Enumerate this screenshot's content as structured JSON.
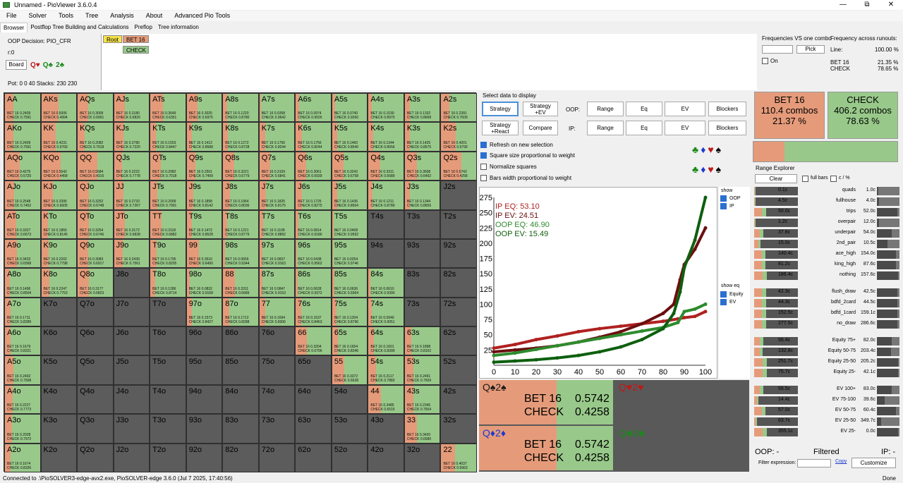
{
  "window": {
    "title": "Unnamed - PioViewer 3.6.0.4",
    "min": "—",
    "max": "⧉",
    "close": "✕"
  },
  "menu": [
    "File",
    "Solver",
    "Tools",
    "Tree",
    "Analysis",
    "About",
    "Advanced Pio Tools"
  ],
  "tabs": [
    "Browser",
    "Postflop Tree Building and Calculations",
    "Preflop",
    "Tree information"
  ],
  "info": {
    "decision": "OOP Decision:  PIO_CFR",
    "r": "r:0",
    "board_button": "Board",
    "cards": [
      "Q♥",
      "Q♣",
      "2♣"
    ],
    "pot": "Pot: 0 0 40 Stacks: 230 230"
  },
  "tree": {
    "root": "Root",
    "bet": "BET 16",
    "check": "CHECK"
  },
  "freq": {
    "vs_one_combo": "Frequencies VS one combo",
    "pick": "Pick",
    "on": "On",
    "across": "Frequency across runouts:",
    "line": "Line:",
    "line_val": "100.00 %",
    "bet": "BET 16",
    "bet_val": "21.35 %",
    "check": "CHECK",
    "check_val": "78.65 %"
  },
  "select": {
    "label": "Select data to display",
    "strategy": "Strategy",
    "strategy_ev": "Strategy\n+EV",
    "strategy_react": "Strategy\n+React",
    "compare": "Compare",
    "oop": "OOP:",
    "ip": "IP:",
    "range": "Range",
    "eq": "Eq",
    "ev": "EV",
    "blockers": "Blockers"
  },
  "checks": {
    "refresh": "Refresh on new selection",
    "square": "Square size proportional to weight",
    "normalize": "Normalize squares",
    "bars": "Bars width proportional to weight"
  },
  "suits": [
    "♣",
    "♦",
    "♥",
    "♠"
  ],
  "actions": {
    "bet_title": "BET 16",
    "bet_combos": "110.4 combos",
    "bet_pct": "21.37 %",
    "check_title": "CHECK",
    "check_combos": "406.2 combos",
    "check_pct": "78.63 %"
  },
  "chart_data": {
    "type": "line",
    "legend": [
      "IP EQ: 53.10",
      "IP EV: 24.51",
      "OOP EQ: 46.90",
      "OOP EV: 15.49"
    ],
    "xlim": [
      0,
      100
    ],
    "ylim": [
      0,
      275
    ],
    "xticks": [
      0,
      10,
      20,
      30,
      40,
      50,
      60,
      70,
      80,
      90,
      100
    ],
    "yticks": [
      0,
      25,
      50,
      75,
      100,
      125,
      150,
      175,
      200,
      225,
      250,
      275
    ],
    "series": [
      {
        "name": "IP EQ",
        "color": "#b02020",
        "x": [
          0,
          10,
          20,
          30,
          40,
          50,
          60,
          70,
          80,
          87,
          90,
          95,
          100
        ],
        "y": [
          28,
          34,
          42,
          48,
          55,
          60,
          64,
          68,
          72,
          76,
          78,
          80,
          88
        ]
      },
      {
        "name": "IP EV",
        "color": "#6b0f0f",
        "x": [
          0,
          10,
          20,
          30,
          40,
          50,
          60,
          70,
          80,
          85,
          88,
          90,
          95,
          100
        ],
        "y": [
          22,
          25,
          28,
          32,
          38,
          46,
          55,
          68,
          85,
          100,
          140,
          165,
          190,
          225
        ]
      },
      {
        "name": "OOP EQ",
        "color": "#2e8b2e",
        "x": [
          0,
          10,
          20,
          30,
          40,
          50,
          60,
          70,
          80,
          87,
          90,
          95,
          100
        ],
        "y": [
          16,
          20,
          26,
          32,
          38,
          44,
          50,
          56,
          62,
          70,
          88,
          92,
          100
        ]
      },
      {
        "name": "OOP EV",
        "color": "#0e5f0e",
        "x": [
          0,
          10,
          20,
          30,
          40,
          50,
          60,
          70,
          80,
          85,
          88,
          90,
          95,
          100
        ],
        "y": [
          5,
          7,
          9,
          12,
          16,
          22,
          30,
          42,
          60,
          85,
          120,
          160,
          205,
          290
        ]
      }
    ]
  },
  "show": {
    "show": "show",
    "oop": "OOP",
    "ip": "IP",
    "show_eq": "show eq",
    "equity": "Equity",
    "ev": "EV"
  },
  "combo_boxes": [
    {
      "cards": "Q♠2♠",
      "color": "#1a1a1a",
      "bet": "BET 16",
      "bet_v": "0.5742",
      "check": "CHECK",
      "check_v": "0.4258",
      "filled": true
    },
    {
      "cards": "Q♥2♥",
      "color": "#c01818",
      "filled": false
    },
    {
      "cards": "Q♦2♦",
      "color": "#1a3ad0",
      "bet": "BET 16",
      "bet_v": "0.5742",
      "check": "CHECK",
      "check_v": "0.4258",
      "filled": true
    },
    {
      "cards": "Q♣2♣",
      "color": "#1a8a1a",
      "filled": false
    }
  ],
  "range_explorer": {
    "title": "Range Explorer",
    "clear": "Clear",
    "full_bars": "full bars",
    "c_pct": "c / %",
    "rows": [
      {
        "l": "0.1c",
        "n": "quads",
        "r": "1.0c",
        "f": 0.05
      },
      {
        "l": "4.5c",
        "n": "fullhouse",
        "r": "4.0c",
        "f": 0.1
      },
      {
        "l": "50.0c",
        "n": "trips",
        "r": "52.0c",
        "f": 0.95
      },
      {
        "l": "1.2c",
        "n": "overpair",
        "r": "12.0c",
        "f": 0.1
      },
      {
        "l": "37.8c",
        "n": "underpair",
        "r": "54.0c",
        "f": 0.7
      },
      {
        "l": "15.0c",
        "n": "2nd_pair",
        "r": "10.5c",
        "f": 0.5
      },
      {
        "l": "140.4c",
        "n": "ace_high",
        "r": "154.0c",
        "f": 0.9
      },
      {
        "l": "81.2c",
        "n": "king_high",
        "r": "87.6c",
        "f": 0.9
      },
      {
        "l": "186.4c",
        "n": "nothing",
        "r": "157.6c",
        "f": 1.0
      },
      {
        "l": "42.3c",
        "n": "flush_draw",
        "r": "42.5c",
        "f": 0.95
      },
      {
        "l": "44.3c",
        "n": "bdfd_2card",
        "r": "44.5c",
        "f": 0.95
      },
      {
        "l": "152.5c",
        "n": "bdfd_1card",
        "r": "159.1c",
        "f": 0.95
      },
      {
        "l": "277.5c",
        "n": "no_draw",
        "r": "286.6c",
        "f": 0.95
      },
      {
        "l": "56.4c",
        "n": "Equity 75+",
        "r": "82.0c",
        "f": 0.7
      },
      {
        "l": "132.8c",
        "n": "Equity 50-75",
        "r": "203.4c",
        "f": 0.65
      },
      {
        "l": "251.7c",
        "n": "Equity 25-50",
        "r": "205.2c",
        "f": 1.0
      },
      {
        "l": "75.7c",
        "n": "Equity 25-",
        "r": "42.1c",
        "f": 1.0
      },
      {
        "l": "56.5c",
        "n": "EV 100+",
        "r": "83.0c",
        "f": 0.7
      },
      {
        "l": "14.4c",
        "n": "EV 75-100",
        "r": "39.6c",
        "f": 0.35
      },
      {
        "l": "57.0c",
        "n": "EV 50-75",
        "r": "60.4c",
        "f": 0.9
      },
      {
        "l": "63.7c",
        "n": "EV 25-50",
        "r": "349.7c",
        "f": 0.2
      },
      {
        "l": "355.1c",
        "n": "EV 25-",
        "r": "0.0c",
        "f": 1.0
      }
    ],
    "oop": "OOP: -",
    "filtered": "Filtered",
    "ip": "IP: -",
    "filter_label": "Filter expression:",
    "copy": "Copy",
    "customize": "Customize"
  },
  "status": {
    "left": "Connected to .\\PioSOLVER3-edge-avx2.exe, PioSOLVER-edge 3.6.0 (Jul  7 2025, 17:40:56)",
    "right": "Done"
  },
  "matrix": {
    "labels": [
      [
        "AA",
        "AKs",
        "AQs",
        "AJs",
        "ATs",
        "A9s",
        "A8s",
        "A7s",
        "A6s",
        "A5s",
        "A4s",
        "A3s",
        "A2s"
      ],
      [
        "AKo",
        "KK",
        "KQs",
        "KJs",
        "KTs",
        "K9s",
        "K8s",
        "K7s",
        "K6s",
        "K5s",
        "K4s",
        "K3s",
        "K2s"
      ],
      [
        "AQo",
        "KQo",
        "QQ",
        "QJs",
        "QTs",
        "Q9s",
        "Q8s",
        "Q7s",
        "Q6s",
        "Q5s",
        "Q4s",
        "Q3s",
        "Q2s"
      ],
      [
        "AJo",
        "KJo",
        "QJo",
        "JJ",
        "JTs",
        "J9s",
        "J8s",
        "J7s",
        "J6s",
        "J5s",
        "J4s",
        "J3s",
        "J2s"
      ],
      [
        "ATo",
        "KTo",
        "QTo",
        "JTo",
        "TT",
        "T9s",
        "T8s",
        "T7s",
        "T6s",
        "T5s",
        "T4s",
        "T3s",
        "T2s"
      ],
      [
        "A9o",
        "K9o",
        "Q9o",
        "J9o",
        "T9o",
        "99",
        "98s",
        "97s",
        "96s",
        "95s",
        "94s",
        "93s",
        "92s"
      ],
      [
        "A8o",
        "K8o",
        "Q8o",
        "J8o",
        "T8o",
        "98o",
        "88",
        "87s",
        "86s",
        "85s",
        "84s",
        "83s",
        "82s"
      ],
      [
        "A7o",
        "K7o",
        "Q7o",
        "J7o",
        "T7o",
        "97o",
        "87o",
        "77",
        "76s",
        "75s",
        "74s",
        "73s",
        "72s"
      ],
      [
        "A6o",
        "K6o",
        "Q6o",
        "J6o",
        "T6o",
        "96o",
        "86o",
        "76o",
        "66",
        "65s",
        "64s",
        "63s",
        "62s"
      ],
      [
        "A5o",
        "K5o",
        "Q5o",
        "J5o",
        "T5o",
        "95o",
        "85o",
        "75o",
        "65o",
        "55",
        "54s",
        "53s",
        "52s"
      ],
      [
        "A4o",
        "K4o",
        "Q4o",
        "J4o",
        "T4o",
        "94o",
        "84o",
        "74o",
        "64o",
        "54o",
        "44",
        "43s",
        "42s"
      ],
      [
        "A3o",
        "K3o",
        "Q3o",
        "J3o",
        "T3o",
        "93o",
        "83o",
        "73o",
        "63o",
        "53o",
        "43o",
        "33",
        "32s"
      ],
      [
        "A2o",
        "K2o",
        "Q2o",
        "J2o",
        "T2o",
        "92o",
        "82o",
        "72o",
        "62o",
        "52o",
        "42o",
        "32o",
        "22"
      ]
    ],
    "bet": [
      [
        0.2409,
        0.5006,
        0.3009,
        0.318,
        0.3649,
        0.3025,
        0.122,
        0.0358,
        0.0974,
        0.074,
        0.103,
        0.1332,
        0.2391
      ],
      [
        0.2409,
        0.4231,
        0.2082,
        0.278,
        0.1553,
        0.1412,
        0.1272,
        0.1756,
        0.1756,
        0.146,
        0.1344,
        0.1425,
        0.4201
      ],
      [
        0.4275,
        0.5542,
        0.5684,
        0.2222,
        0.2982,
        0.2501,
        0.3221,
        0.3159,
        0.3061,
        0.3242,
        0.3311,
        0.3508,
        0.5742
      ],
      [
        0.2548,
        0.3395,
        0.3252,
        0.2733,
        0.2009,
        0.1858,
        0.1964,
        0.1825,
        0.1725,
        0.1436,
        0.1211,
        0.1344,
        null
      ],
      [
        0.3327,
        0.1855,
        0.3254,
        0.3172,
        0.3118,
        0.1472,
        0.1221,
        0.1108,
        0.0814,
        0.0408,
        null,
        null,
        null
      ],
      [
        0.3432,
        0.2202,
        0.3083,
        0.2439,
        0.1795,
        0.351,
        0.0656,
        0.0837,
        0.0438,
        0.0254,
        null,
        null,
        null
      ],
      [
        0.1496,
        0.2247,
        0.3177,
        null,
        0.1286,
        0.0832,
        0.3311,
        0.0847,
        0.0628,
        0.0636,
        0.061,
        null,
        null
      ],
      [
        0.1711,
        null,
        null,
        null,
        null,
        0.1573,
        0.1712,
        0.1694,
        0.1537,
        0.1204,
        0.0949,
        null,
        null
      ],
      [
        0.1679,
        null,
        null,
        null,
        null,
        null,
        null,
        null,
        0.3204,
        0.1654,
        0.1601,
        0.1898,
        null
      ],
      [
        0.2492,
        null,
        null,
        null,
        null,
        null,
        null,
        null,
        null,
        0.3372,
        0.2117,
        0.2491,
        null
      ],
      [
        0.2227,
        null,
        null,
        null,
        null,
        null,
        null,
        null,
        null,
        null,
        0.3485,
        0.2346,
        null
      ],
      [
        0.2028,
        null,
        null,
        null,
        null,
        null,
        null,
        null,
        null,
        null,
        null,
        0.342,
        null
      ],
      [
        0.1674,
        null,
        null,
        null,
        null,
        null,
        null,
        null,
        null,
        null,
        null,
        null,
        0.4037
      ]
    ]
  }
}
